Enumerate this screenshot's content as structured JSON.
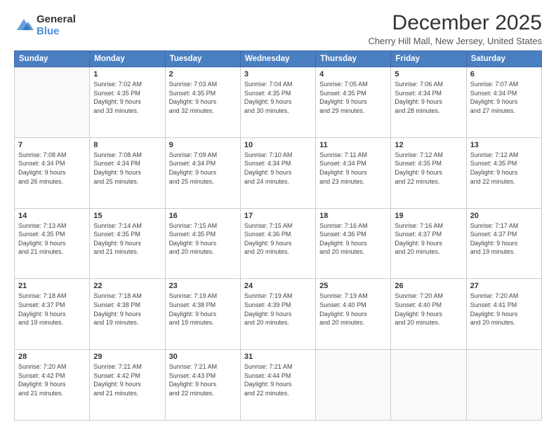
{
  "logo": {
    "general": "General",
    "blue": "Blue"
  },
  "title": "December 2025",
  "location": "Cherry Hill Mall, New Jersey, United States",
  "days": [
    "Sunday",
    "Monday",
    "Tuesday",
    "Wednesday",
    "Thursday",
    "Friday",
    "Saturday"
  ],
  "weeks": [
    [
      {
        "day": "",
        "info": ""
      },
      {
        "day": "1",
        "info": "Sunrise: 7:02 AM\nSunset: 4:35 PM\nDaylight: 9 hours\nand 33 minutes."
      },
      {
        "day": "2",
        "info": "Sunrise: 7:03 AM\nSunset: 4:35 PM\nDaylight: 9 hours\nand 32 minutes."
      },
      {
        "day": "3",
        "info": "Sunrise: 7:04 AM\nSunset: 4:35 PM\nDaylight: 9 hours\nand 30 minutes."
      },
      {
        "day": "4",
        "info": "Sunrise: 7:05 AM\nSunset: 4:35 PM\nDaylight: 9 hours\nand 29 minutes."
      },
      {
        "day": "5",
        "info": "Sunrise: 7:06 AM\nSunset: 4:34 PM\nDaylight: 9 hours\nand 28 minutes."
      },
      {
        "day": "6",
        "info": "Sunrise: 7:07 AM\nSunset: 4:34 PM\nDaylight: 9 hours\nand 27 minutes."
      }
    ],
    [
      {
        "day": "7",
        "info": "Sunrise: 7:08 AM\nSunset: 4:34 PM\nDaylight: 9 hours\nand 26 minutes."
      },
      {
        "day": "8",
        "info": "Sunrise: 7:08 AM\nSunset: 4:34 PM\nDaylight: 9 hours\nand 25 minutes."
      },
      {
        "day": "9",
        "info": "Sunrise: 7:09 AM\nSunset: 4:34 PM\nDaylight: 9 hours\nand 25 minutes."
      },
      {
        "day": "10",
        "info": "Sunrise: 7:10 AM\nSunset: 4:34 PM\nDaylight: 9 hours\nand 24 minutes."
      },
      {
        "day": "11",
        "info": "Sunrise: 7:11 AM\nSunset: 4:34 PM\nDaylight: 9 hours\nand 23 minutes."
      },
      {
        "day": "12",
        "info": "Sunrise: 7:12 AM\nSunset: 4:35 PM\nDaylight: 9 hours\nand 22 minutes."
      },
      {
        "day": "13",
        "info": "Sunrise: 7:12 AM\nSunset: 4:35 PM\nDaylight: 9 hours\nand 22 minutes."
      }
    ],
    [
      {
        "day": "14",
        "info": "Sunrise: 7:13 AM\nSunset: 4:35 PM\nDaylight: 9 hours\nand 21 minutes."
      },
      {
        "day": "15",
        "info": "Sunrise: 7:14 AM\nSunset: 4:35 PM\nDaylight: 9 hours\nand 21 minutes."
      },
      {
        "day": "16",
        "info": "Sunrise: 7:15 AM\nSunset: 4:35 PM\nDaylight: 9 hours\nand 20 minutes."
      },
      {
        "day": "17",
        "info": "Sunrise: 7:15 AM\nSunset: 4:36 PM\nDaylight: 9 hours\nand 20 minutes."
      },
      {
        "day": "18",
        "info": "Sunrise: 7:16 AM\nSunset: 4:36 PM\nDaylight: 9 hours\nand 20 minutes."
      },
      {
        "day": "19",
        "info": "Sunrise: 7:16 AM\nSunset: 4:37 PM\nDaylight: 9 hours\nand 20 minutes."
      },
      {
        "day": "20",
        "info": "Sunrise: 7:17 AM\nSunset: 4:37 PM\nDaylight: 9 hours\nand 19 minutes."
      }
    ],
    [
      {
        "day": "21",
        "info": "Sunrise: 7:18 AM\nSunset: 4:37 PM\nDaylight: 9 hours\nand 19 minutes."
      },
      {
        "day": "22",
        "info": "Sunrise: 7:18 AM\nSunset: 4:38 PM\nDaylight: 9 hours\nand 19 minutes."
      },
      {
        "day": "23",
        "info": "Sunrise: 7:19 AM\nSunset: 4:38 PM\nDaylight: 9 hours\nand 19 minutes."
      },
      {
        "day": "24",
        "info": "Sunrise: 7:19 AM\nSunset: 4:39 PM\nDaylight: 9 hours\nand 20 minutes."
      },
      {
        "day": "25",
        "info": "Sunrise: 7:19 AM\nSunset: 4:40 PM\nDaylight: 9 hours\nand 20 minutes."
      },
      {
        "day": "26",
        "info": "Sunrise: 7:20 AM\nSunset: 4:40 PM\nDaylight: 9 hours\nand 20 minutes."
      },
      {
        "day": "27",
        "info": "Sunrise: 7:20 AM\nSunset: 4:41 PM\nDaylight: 9 hours\nand 20 minutes."
      }
    ],
    [
      {
        "day": "28",
        "info": "Sunrise: 7:20 AM\nSunset: 4:42 PM\nDaylight: 9 hours\nand 21 minutes."
      },
      {
        "day": "29",
        "info": "Sunrise: 7:21 AM\nSunset: 4:42 PM\nDaylight: 9 hours\nand 21 minutes."
      },
      {
        "day": "30",
        "info": "Sunrise: 7:21 AM\nSunset: 4:43 PM\nDaylight: 9 hours\nand 22 minutes."
      },
      {
        "day": "31",
        "info": "Sunrise: 7:21 AM\nSunset: 4:44 PM\nDaylight: 9 hours\nand 22 minutes."
      },
      {
        "day": "",
        "info": ""
      },
      {
        "day": "",
        "info": ""
      },
      {
        "day": "",
        "info": ""
      }
    ]
  ]
}
